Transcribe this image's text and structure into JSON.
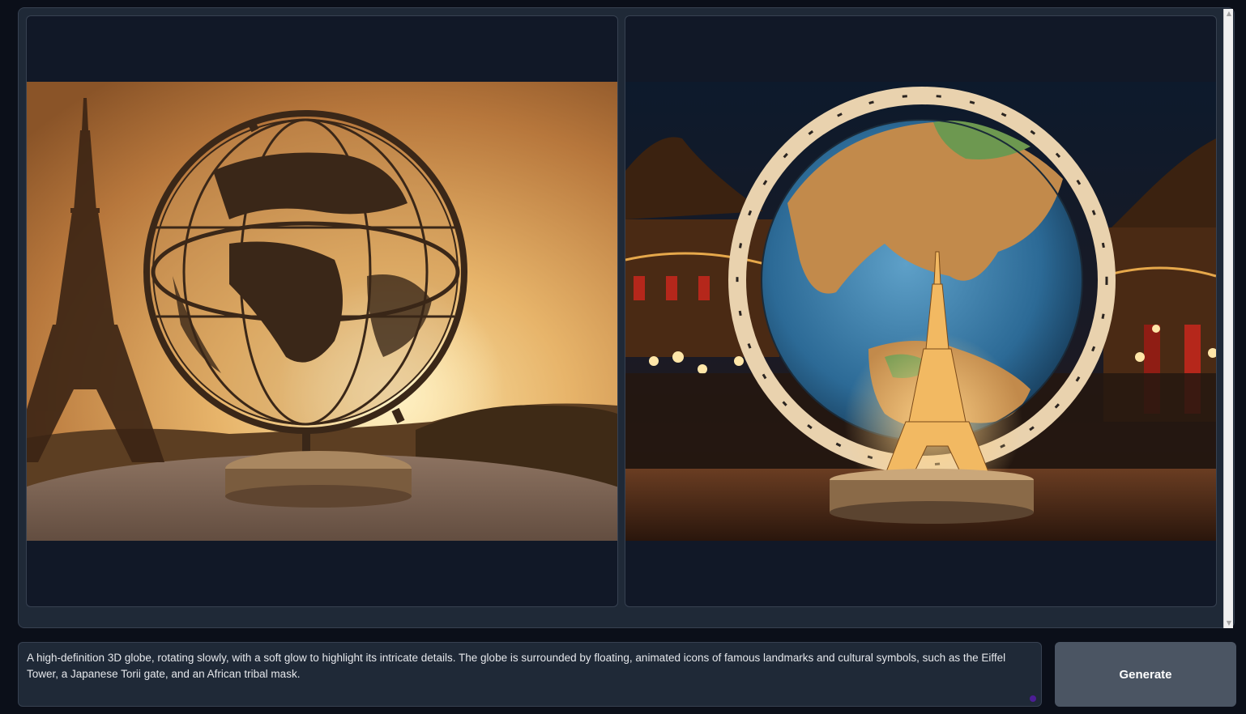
{
  "gallery": {
    "images": [
      {
        "alt": "Silhouette globe with Eiffel Tower at sunset"
      },
      {
        "alt": "Illuminated globe with Eiffel Tower inside"
      }
    ]
  },
  "prompt": {
    "value": "A high-definition 3D globe, rotating slowly, with a soft glow to highlight its intricate details. The globe is surrounded by floating, animated icons of famous landmarks and cultural symbols, such as the Eiffel Tower, a Japanese Torii gate, and an African tribal mask."
  },
  "generate": {
    "label": "Generate"
  },
  "scrollbar": {
    "up_icon": "▲",
    "down_icon": "▼"
  }
}
